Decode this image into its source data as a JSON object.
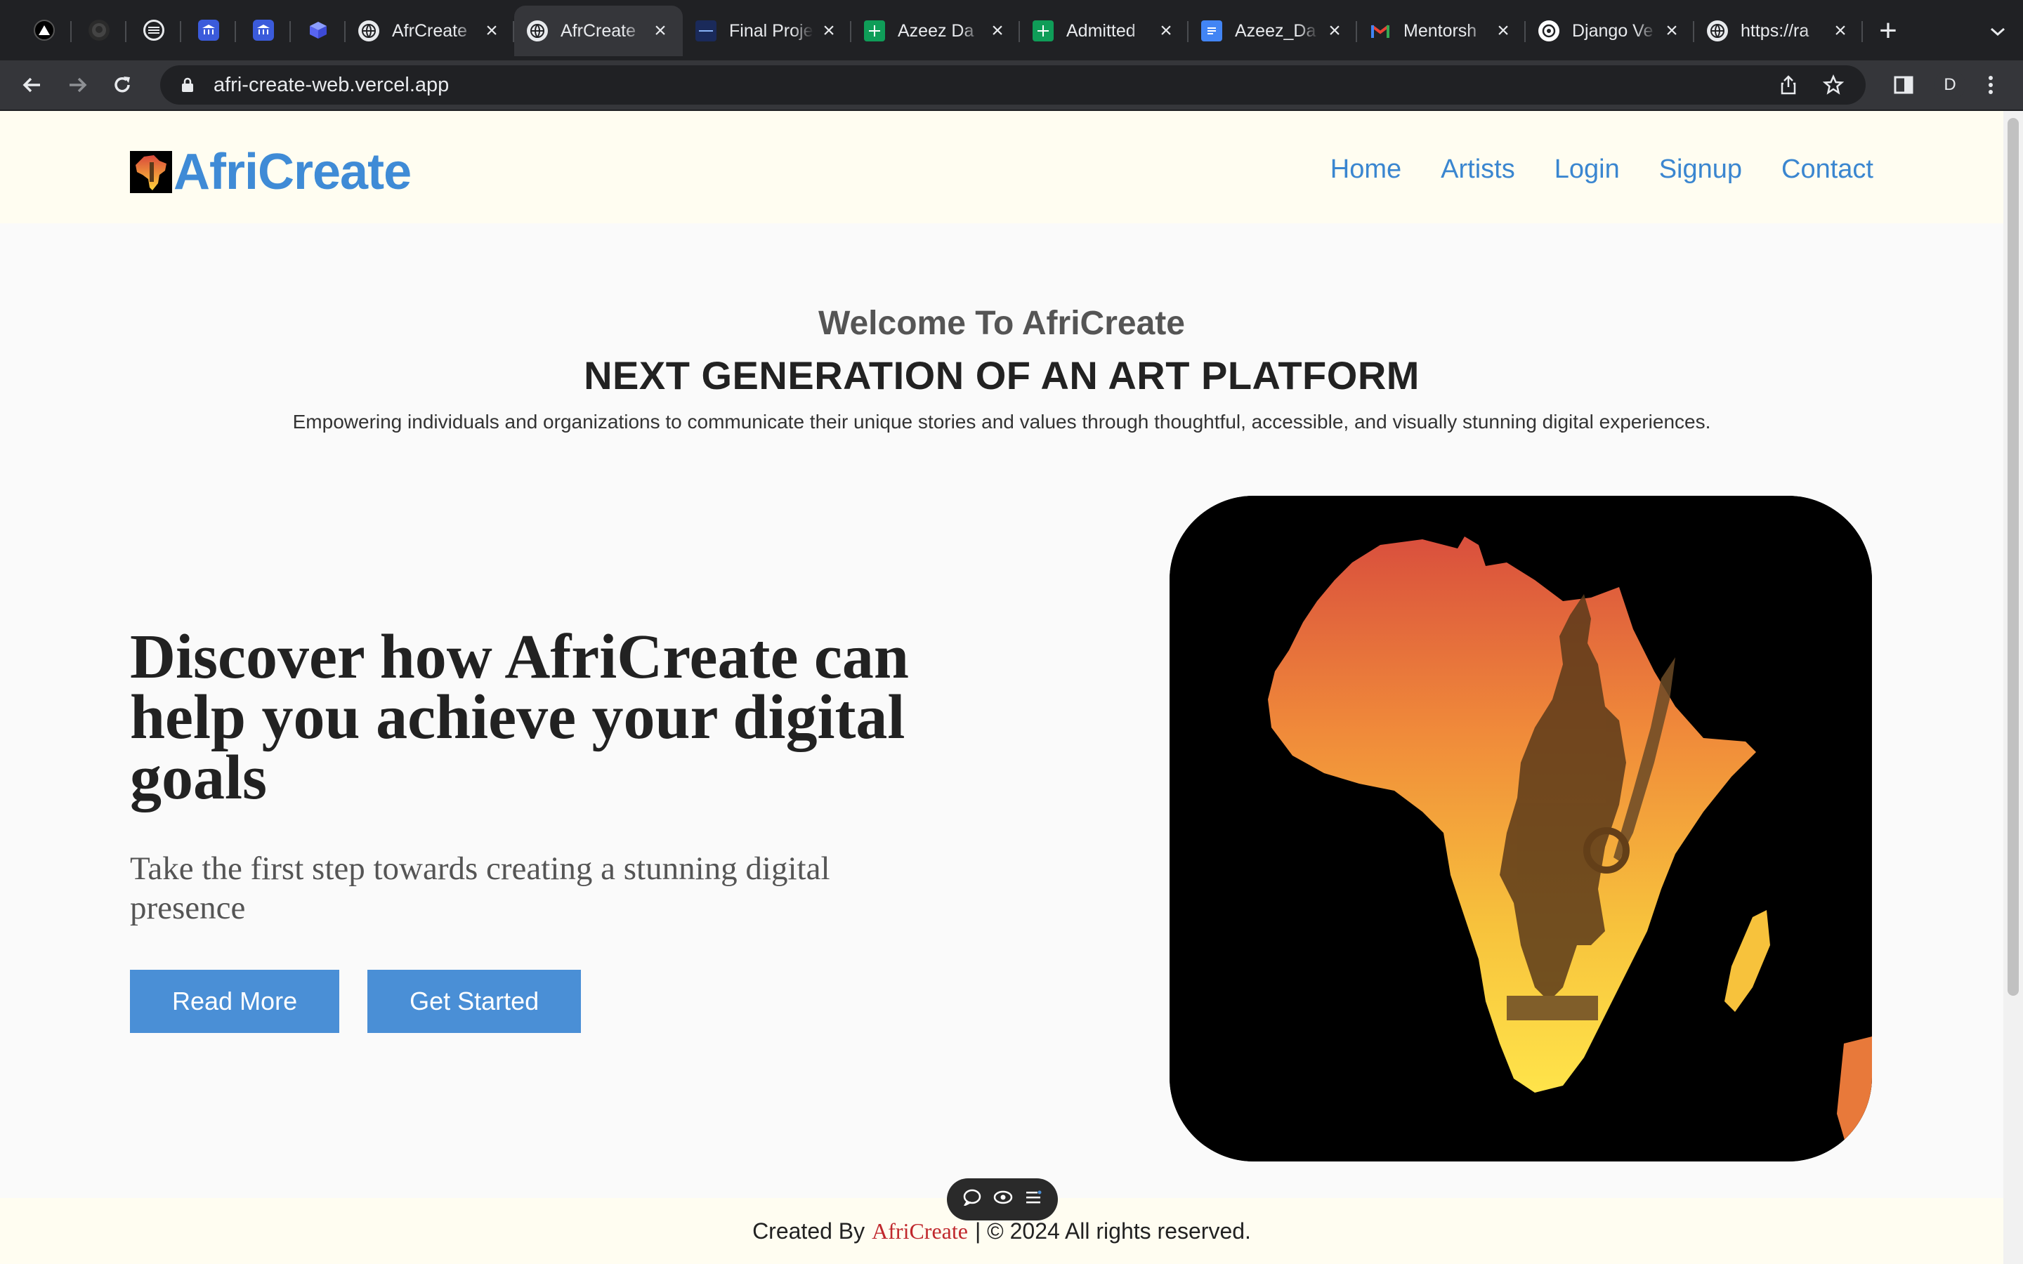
{
  "browser": {
    "pinned_tabs": [
      {
        "icon": "vercel-icon",
        "color": "#ffffff"
      },
      {
        "icon": "github-icon",
        "color": "#3a3a3a"
      },
      {
        "icon": "circle-lines-icon",
        "color": "#ffffff"
      },
      {
        "icon": "bank-icon",
        "color": "#3b5bdb"
      },
      {
        "icon": "bank-icon",
        "color": "#3b5bdb"
      },
      {
        "icon": "cube-icon",
        "color": "#5865f2"
      }
    ],
    "tabs": [
      {
        "title": "AfrCreate",
        "icon": "globe-icon",
        "active": false
      },
      {
        "title": "AfrCreate",
        "icon": "globe-icon",
        "active": true
      },
      {
        "title": "Final Proje",
        "icon": "doc-dark-icon",
        "active": false
      },
      {
        "title": "Azeez Da",
        "icon": "sheets-icon",
        "active": false
      },
      {
        "title": "Admitted",
        "icon": "sheets-icon",
        "active": false
      },
      {
        "title": "Azeez_Da",
        "icon": "docs-icon",
        "active": false
      },
      {
        "title": "Mentorsh",
        "icon": "gmail-icon",
        "active": false
      },
      {
        "title": "Django Ve",
        "icon": "openai-icon",
        "active": false
      },
      {
        "title": "https://ra",
        "icon": "globe-icon",
        "active": false
      }
    ],
    "close_glyph": "×",
    "new_tab_glyph": "+",
    "url": "afri-create-web.vercel.app",
    "profile_initial": "D"
  },
  "site": {
    "brand": "AfriCreate",
    "nav": [
      "Home",
      "Artists",
      "Login",
      "Signup",
      "Contact"
    ],
    "welcome": "Welcome To AfriCreate",
    "tagline": "NEXT GENERATION OF AN ART PLATFORM",
    "subtext": "Empowering individuals and organizations to communicate their unique stories and values through thoughtful, accessible, and visually stunning digital experiences.",
    "headline": "Discover how AfriCreate can help you achieve your digital goals",
    "subhead": "Take the first step towards creating a stunning digital presence",
    "buttons": {
      "read_more": "Read More",
      "get_started": "Get Started"
    },
    "footer": {
      "prefix": "Created By",
      "brand": "AfriCreate",
      "suffix": "| © 2024 All rights reserved."
    }
  },
  "colors": {
    "brand_blue": "#3f8bd6",
    "button_blue": "#4a8fd6",
    "header_bg": "#fffdf1",
    "footer_brand": "#c0282d"
  }
}
